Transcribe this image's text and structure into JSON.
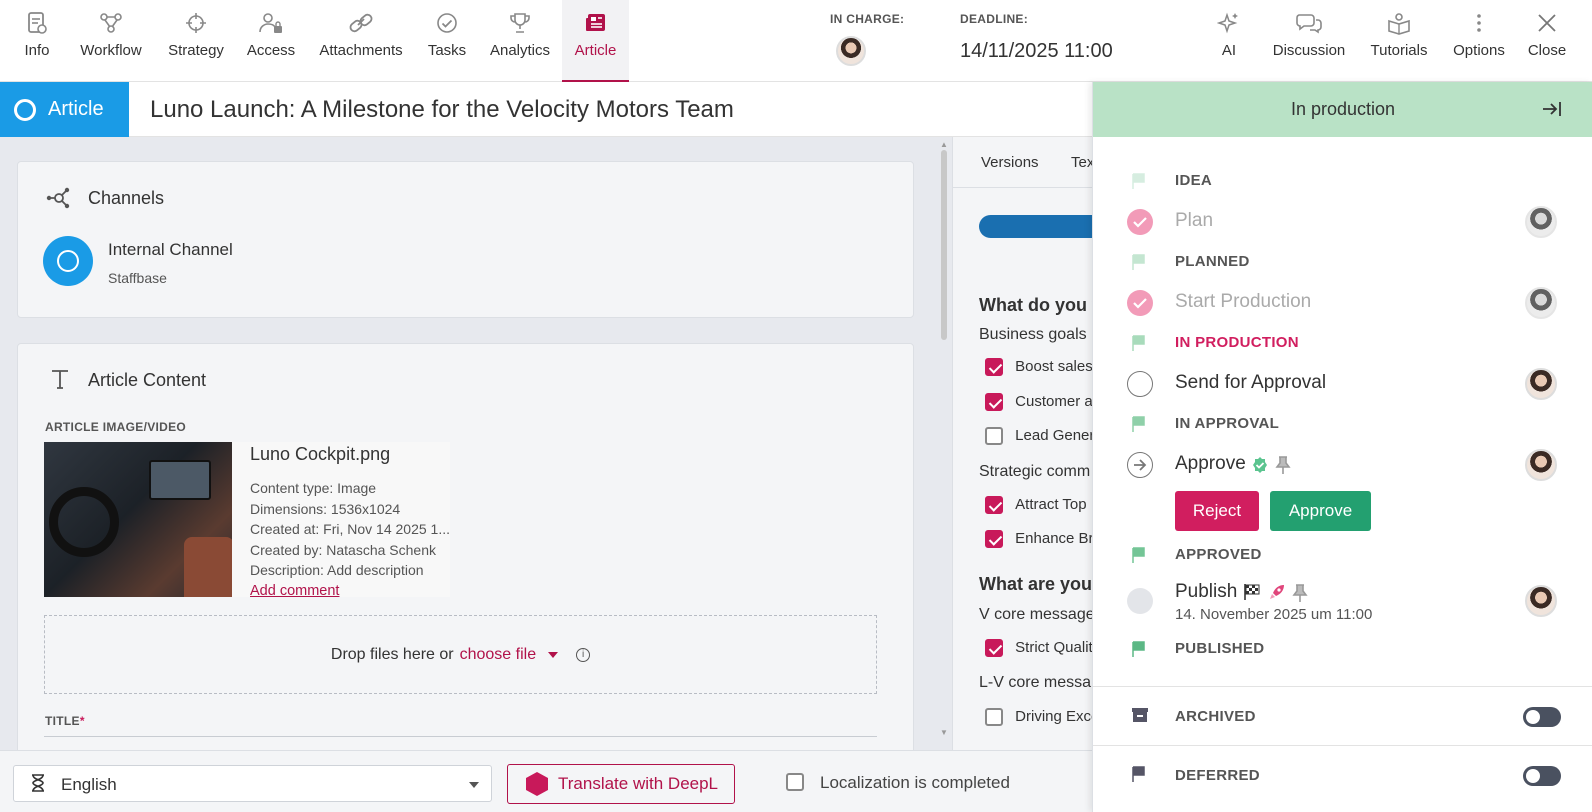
{
  "colors": {
    "accent": "#b1124a",
    "brand_blue": "#1a9be6",
    "status_green": "#b9e2c6",
    "reject": "#d11e5f",
    "approve": "#23a070"
  },
  "nav": {
    "tabs": [
      {
        "label": "Info",
        "icon": "info-doc-icon"
      },
      {
        "label": "Workflow",
        "icon": "workflow-icon"
      },
      {
        "label": "Strategy",
        "icon": "crosshair-icon"
      },
      {
        "label": "Access",
        "icon": "user-lock-icon"
      },
      {
        "label": "Attachments",
        "icon": "link-icon"
      },
      {
        "label": "Tasks",
        "icon": "check-circle-icon"
      },
      {
        "label": "Analytics",
        "icon": "trophy-icon"
      },
      {
        "label": "Article",
        "icon": "newspaper-icon"
      }
    ],
    "right": [
      {
        "label": "AI",
        "icon": "sparkle-icon"
      },
      {
        "label": "Discussion",
        "icon": "chat-icon"
      },
      {
        "label": "Tutorials",
        "icon": "book-icon"
      },
      {
        "label": "Options",
        "icon": "more-vertical-icon"
      },
      {
        "label": "Close",
        "icon": "close-icon"
      }
    ]
  },
  "header": {
    "in_charge_label": "IN CHARGE:",
    "deadline_label": "DEADLINE:",
    "deadline_value": "14/11/2025 11:00"
  },
  "title_bar": {
    "type": "Article",
    "title": "Luno Launch: A Milestone for the Velocity Motors Team"
  },
  "channels": {
    "heading": "Channels",
    "name": "Internal Channel",
    "sub": "Staffbase"
  },
  "content": {
    "heading": "Article Content",
    "media_label": "ARTICLE IMAGE/VIDEO",
    "file_name": "Luno Cockpit.png",
    "meta": [
      "Content type: Image",
      "Dimensions: 1536x1024",
      "Created at: Fri, Nov 14 2025 1...",
      "Created by: Natascha Schenk",
      "Description: Add description"
    ],
    "add_comment": "Add comment",
    "drop_text": "Drop files here or",
    "choose_file": "choose file",
    "title_label": "TITLE",
    "required_mark": "*"
  },
  "strategy": {
    "tabs": [
      "Versions",
      "Tex"
    ],
    "q1": "What do you w",
    "business_goals": "Business goals",
    "goals": [
      {
        "label": "Boost sales",
        "checked": true
      },
      {
        "label": "Customer a",
        "checked": true
      },
      {
        "label": "Lead Gener",
        "checked": false
      }
    ],
    "strategic": "Strategic comm",
    "strat_items": [
      {
        "label": "Attract Top",
        "checked": true
      },
      {
        "label": "Enhance Br",
        "checked": true
      }
    ],
    "q2": "What are you",
    "core1": "V core message",
    "core1_items": [
      {
        "label": "Strict Qualit",
        "checked": true
      }
    ],
    "core2": "L-V core messa",
    "core2_items": [
      {
        "label": "Driving Exce",
        "checked": false
      }
    ]
  },
  "bottom": {
    "language": "English",
    "translate": "Translate with DeepL",
    "localization": "Localization is completed"
  },
  "workflow": {
    "status": "In production",
    "stages": {
      "idea": "IDEA",
      "planned": "PLANNED",
      "in_production": "IN PRODUCTION",
      "in_approval": "IN APPROVAL",
      "approved": "APPROVED",
      "published": "PUBLISHED"
    },
    "steps": {
      "plan": "Plan",
      "start_production": "Start Production",
      "send_for_approval": "Send for Approval",
      "approve": "Approve",
      "publish": "Publish",
      "publish_date": "14. November 2025 um 11:00"
    },
    "buttons": {
      "reject": "Reject",
      "approve": "Approve"
    },
    "archived": "ARCHIVED",
    "deferred": "DEFERRED"
  }
}
